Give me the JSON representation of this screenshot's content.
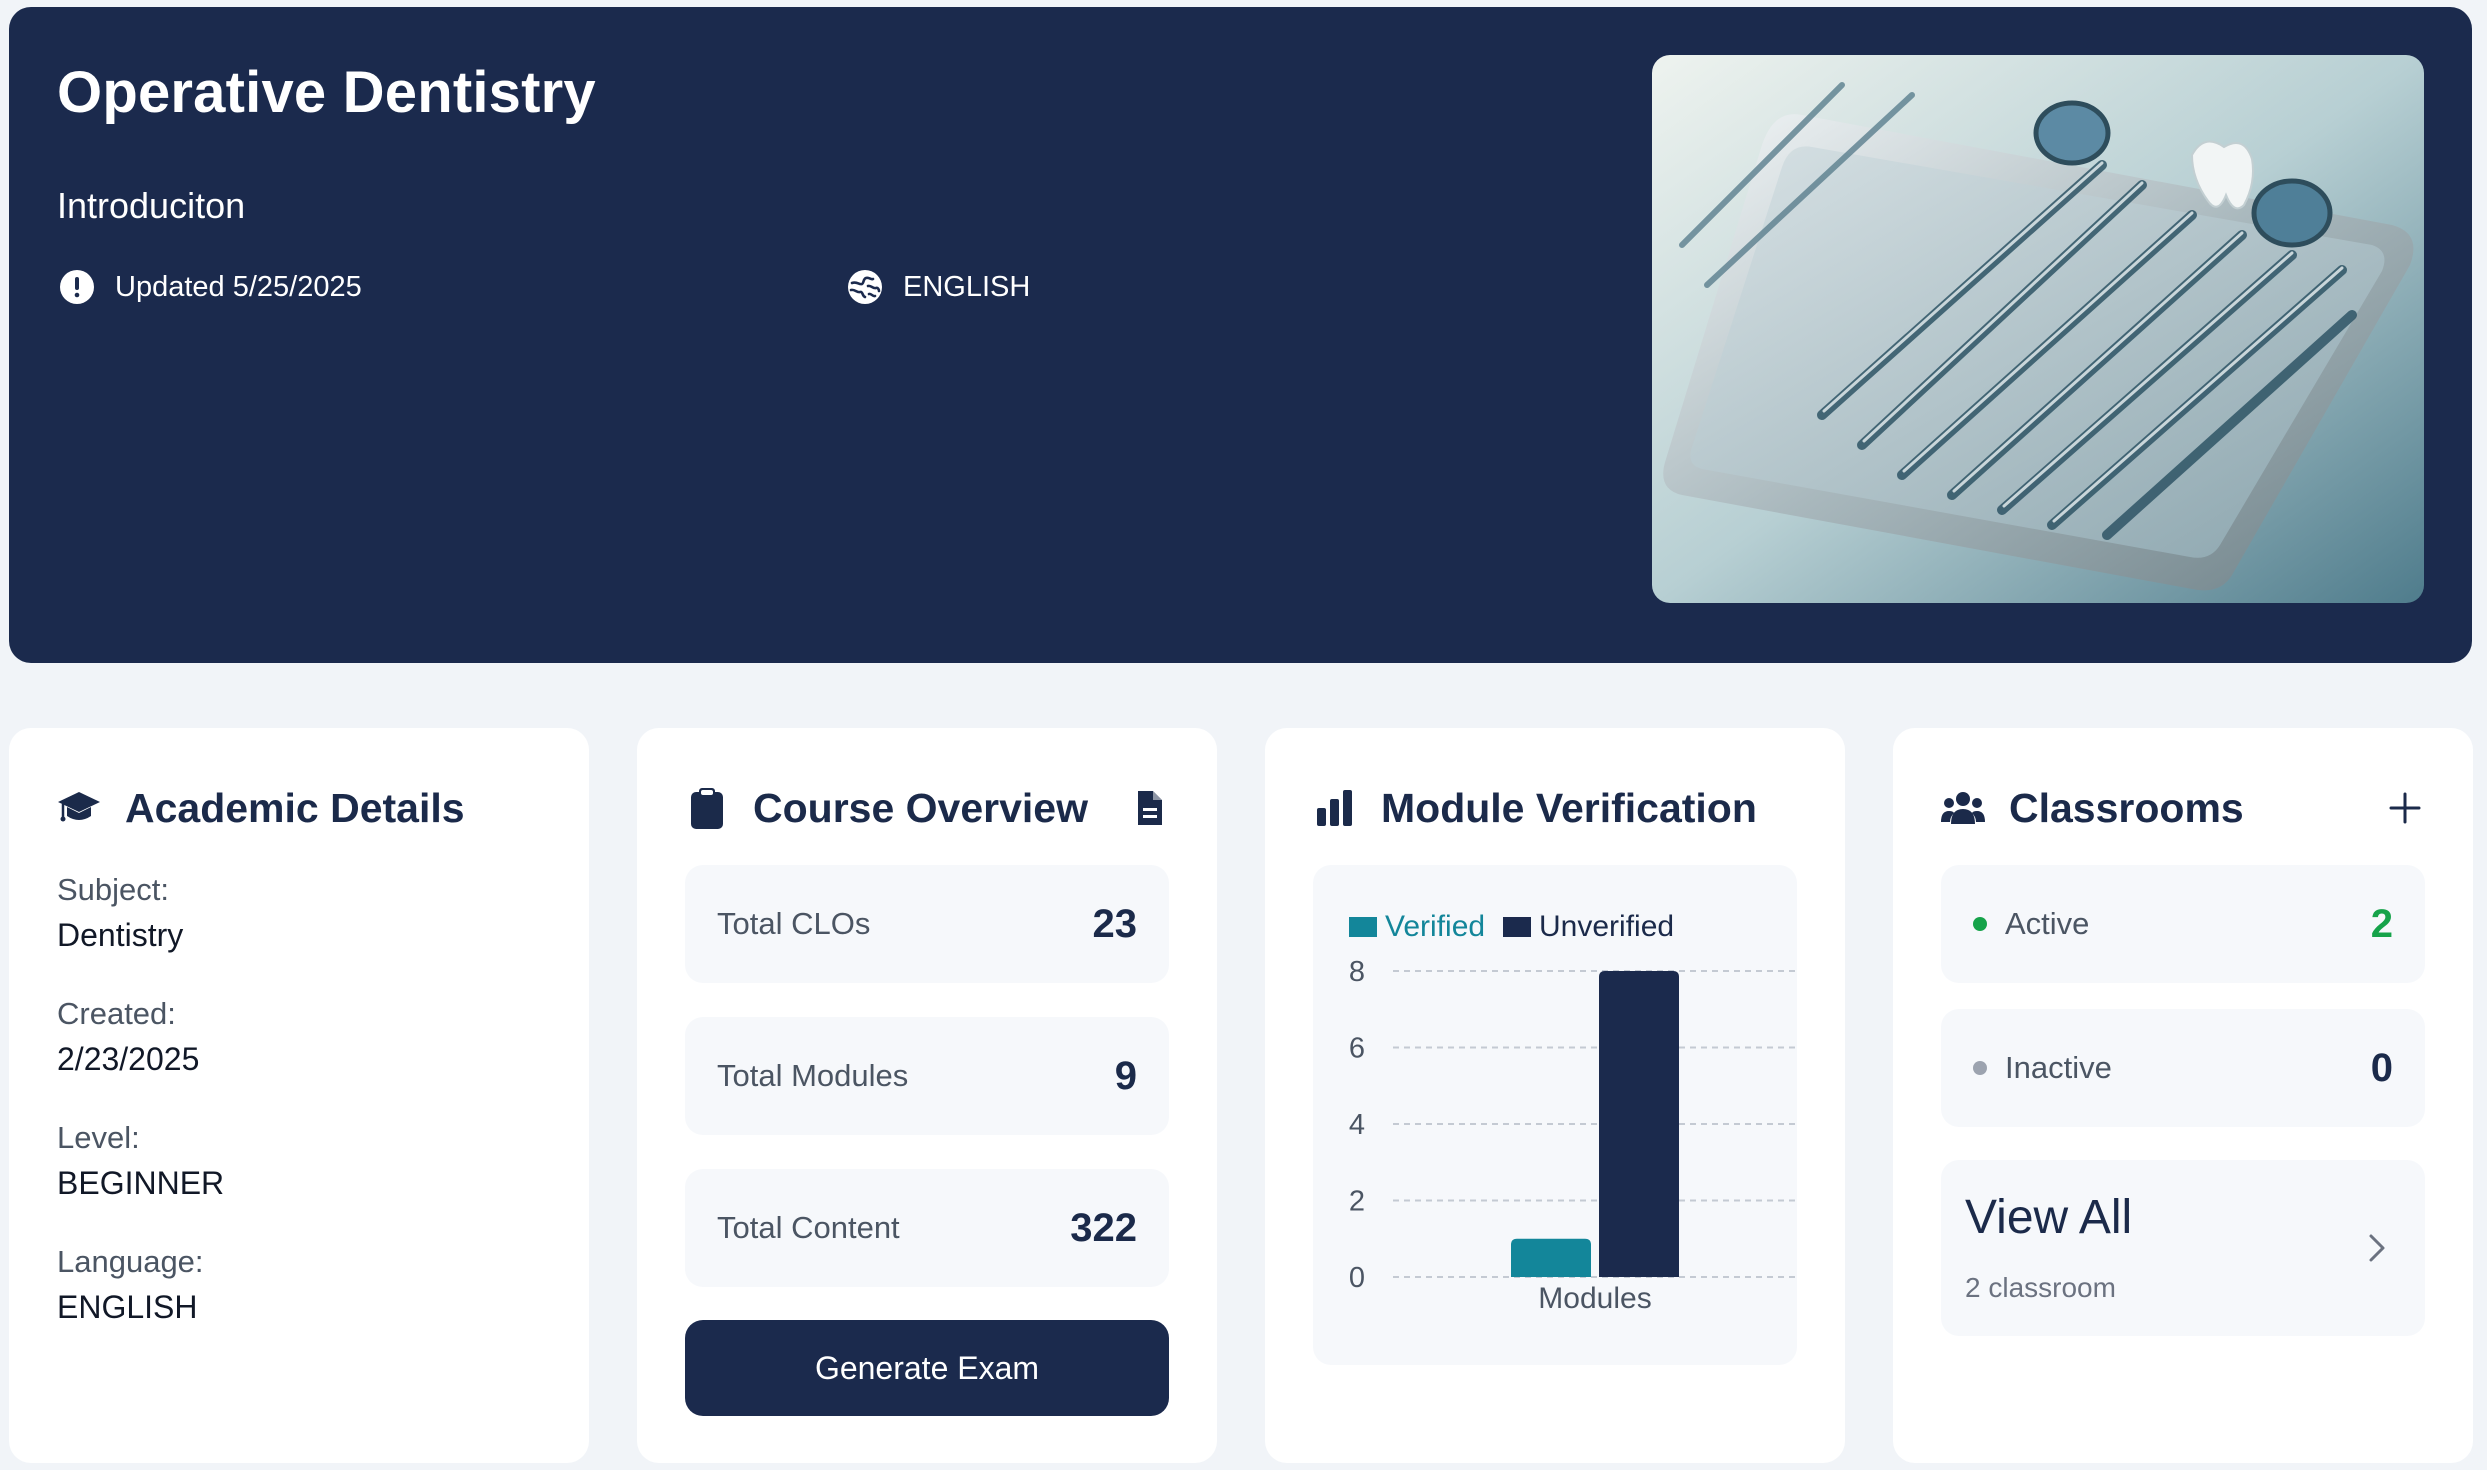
{
  "hero": {
    "title": "Operative Dentistry",
    "subtitle": "Introduciton",
    "updated": "Updated 5/25/2025",
    "language": "ENGLISH",
    "image_icon": "dental-instruments-tray-image"
  },
  "academic": {
    "title": "Academic Details",
    "icon": "graduation-cap-icon",
    "items": [
      {
        "label": "Subject:",
        "value": "Dentistry"
      },
      {
        "label": "Created:",
        "value": "2/23/2025"
      },
      {
        "label": "Level:",
        "value": "BEGINNER"
      },
      {
        "label": "Language:",
        "value": "ENGLISH"
      }
    ]
  },
  "overview": {
    "title": "Course Overview",
    "icon": "clipboard-icon",
    "action_icon": "document-icon",
    "stats": [
      {
        "label": "Total CLOs",
        "value": "23"
      },
      {
        "label": "Total Modules",
        "value": "9"
      },
      {
        "label": "Total Content",
        "value": "322"
      }
    ],
    "button": "Generate Exam"
  },
  "verification": {
    "title": "Module Verification",
    "icon": "bar-chart-icon"
  },
  "chart_data": {
    "type": "bar",
    "categories": [
      "Modules"
    ],
    "series": [
      {
        "name": "Verified",
        "values": [
          1
        ],
        "color": "#13869a"
      },
      {
        "name": "Unverified",
        "values": [
          8
        ],
        "color": "#1b2a4d"
      }
    ],
    "xlabel": "Modules",
    "ylabel": "",
    "ylim": [
      0,
      8
    ],
    "yticks": [
      "0",
      "2",
      "4",
      "6",
      "8"
    ],
    "grid": true,
    "legend": "top-left"
  },
  "classrooms": {
    "title": "Classrooms",
    "icon": "users-icon",
    "action_icon": "plus-icon",
    "active_label": "Active",
    "active_value": "2",
    "active_color": "#16a34a",
    "inactive_label": "Inactive",
    "inactive_value": "0",
    "inactive_color": "#9ca3af",
    "view_all": "View All",
    "view_all_sub": "2 classroom"
  },
  "colors": {
    "navy": "#1b2a4d",
    "teal": "#13869a",
    "page_bg": "#f1f4f8"
  }
}
